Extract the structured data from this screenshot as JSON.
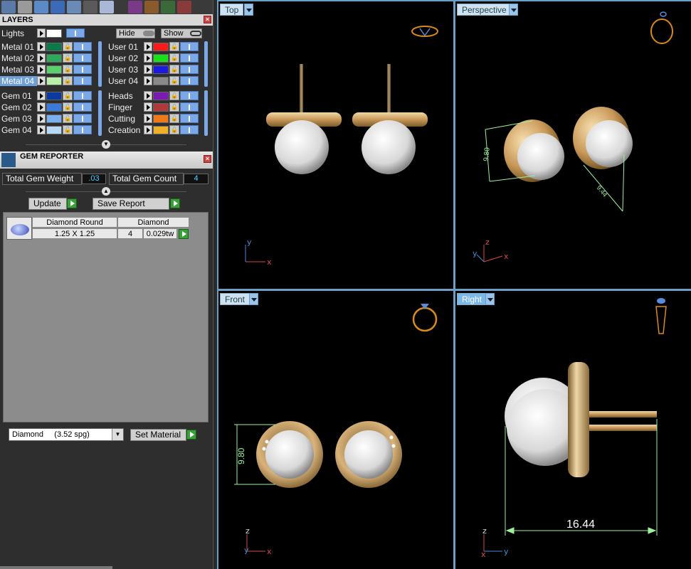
{
  "layers": {
    "title": "LAYERS",
    "lights_label": "Lights",
    "hide_label": "Hide",
    "show_label": "Show",
    "metal_layers": [
      {
        "name": "Metal 01",
        "color": "#0a7a4a",
        "selected": false
      },
      {
        "name": "Metal 02",
        "color": "#2ea85a",
        "selected": false
      },
      {
        "name": "Metal 03",
        "color": "#5ad06a",
        "selected": false
      },
      {
        "name": "Metal 04",
        "color": "#b8f0a8",
        "selected": true
      }
    ],
    "user_layers": [
      {
        "name": "User 01",
        "color": "#ff1a1a"
      },
      {
        "name": "User 02",
        "color": "#1ae01a"
      },
      {
        "name": "User 03",
        "color": "#1a1ae0"
      },
      {
        "name": "User 04",
        "color": "#8a8a8a"
      }
    ],
    "gem_layers": [
      {
        "name": "Gem 01",
        "color": "#0a3aa0"
      },
      {
        "name": "Gem 02",
        "color": "#3a7ad8"
      },
      {
        "name": "Gem 03",
        "color": "#7ab0f0"
      },
      {
        "name": "Gem 04",
        "color": "#b8d8f8"
      }
    ],
    "other_layers": [
      {
        "name": "Heads",
        "color": "#7a1ab0"
      },
      {
        "name": "Finger",
        "color": "#b03a3a"
      },
      {
        "name": "Cutting",
        "color": "#f07a1a"
      },
      {
        "name": "Creation",
        "color": "#f0b02a"
      }
    ]
  },
  "gem_reporter": {
    "title": "GEM REPORTER",
    "total_weight_label": "Total Gem Weight",
    "total_weight_value": ".03",
    "total_count_label": "Total Gem Count",
    "total_count_value": "4",
    "update_label": "Update",
    "save_report_label": "Save Report",
    "table": {
      "headers": [
        "Diamond Round",
        "Diamond"
      ],
      "row": {
        "size": "1.25 X 1.25",
        "count": "4",
        "weight": "0.029tw"
      }
    },
    "material_select": "Diamond     (3.52 spg)",
    "set_material_label": "Set Material"
  },
  "viewports": {
    "top": {
      "label": "Top",
      "axes": {
        "vertical": "y",
        "horizontal": "x"
      }
    },
    "perspective": {
      "label": "Perspective",
      "axes": {
        "vertical": "z",
        "horizontal": "x",
        "depth": "y"
      },
      "dimensions": [
        "9.80",
        "9.44"
      ]
    },
    "front": {
      "label": "Front",
      "axes": {
        "vertical": "z",
        "horizontal": "x",
        "depth": "y"
      },
      "dimensions": [
        "9.80"
      ]
    },
    "right": {
      "label": "Right",
      "axes": {
        "vertical": "z",
        "horizontal": "y",
        "depth": "x"
      },
      "dimensions": [
        "16.44"
      ],
      "active": true
    }
  },
  "colors": {
    "gold": "#d9b37a",
    "pearl": "#f0f0f0",
    "dimension_line": "#9ef09e",
    "viewport_frame": "#6aa0c8",
    "tab_active": "#7ab8ea"
  }
}
